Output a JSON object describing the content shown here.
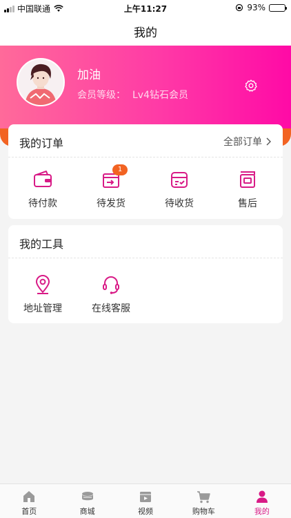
{
  "status_bar": {
    "carrier": "中国联通",
    "time": "上午11:27",
    "battery": "93%",
    "battery_level": 0.93
  },
  "nav": {
    "title": "我的"
  },
  "profile": {
    "name": "加油",
    "level_label": "会员等级：",
    "level_value": "Lv4钻石会员"
  },
  "orders": {
    "title": "我的订单",
    "all_label": "全部订单",
    "items": [
      {
        "label": "待付款",
        "icon": "wallet-icon"
      },
      {
        "label": "待发货",
        "icon": "ship-box-icon",
        "badge": "1"
      },
      {
        "label": "待收货",
        "icon": "receive-box-icon"
      },
      {
        "label": "售后",
        "icon": "after-sale-icon"
      }
    ]
  },
  "tools": {
    "title": "我的工具",
    "items": [
      {
        "label": "地址管理",
        "icon": "location-pin-icon"
      },
      {
        "label": "在线客服",
        "icon": "headset-icon"
      }
    ]
  },
  "tabs": [
    {
      "label": "首页",
      "icon": "home-icon"
    },
    {
      "label": "商城",
      "icon": "store-icon"
    },
    {
      "label": "视频",
      "icon": "video-icon"
    },
    {
      "label": "购物车",
      "icon": "cart-icon"
    },
    {
      "label": "我的",
      "icon": "profile-icon",
      "active": true
    }
  ],
  "colors": {
    "accent": "#d81a86",
    "header_gradient_start": "#ff6a9a",
    "header_gradient_end": "#ff0aa6",
    "orange": "#f26322"
  }
}
